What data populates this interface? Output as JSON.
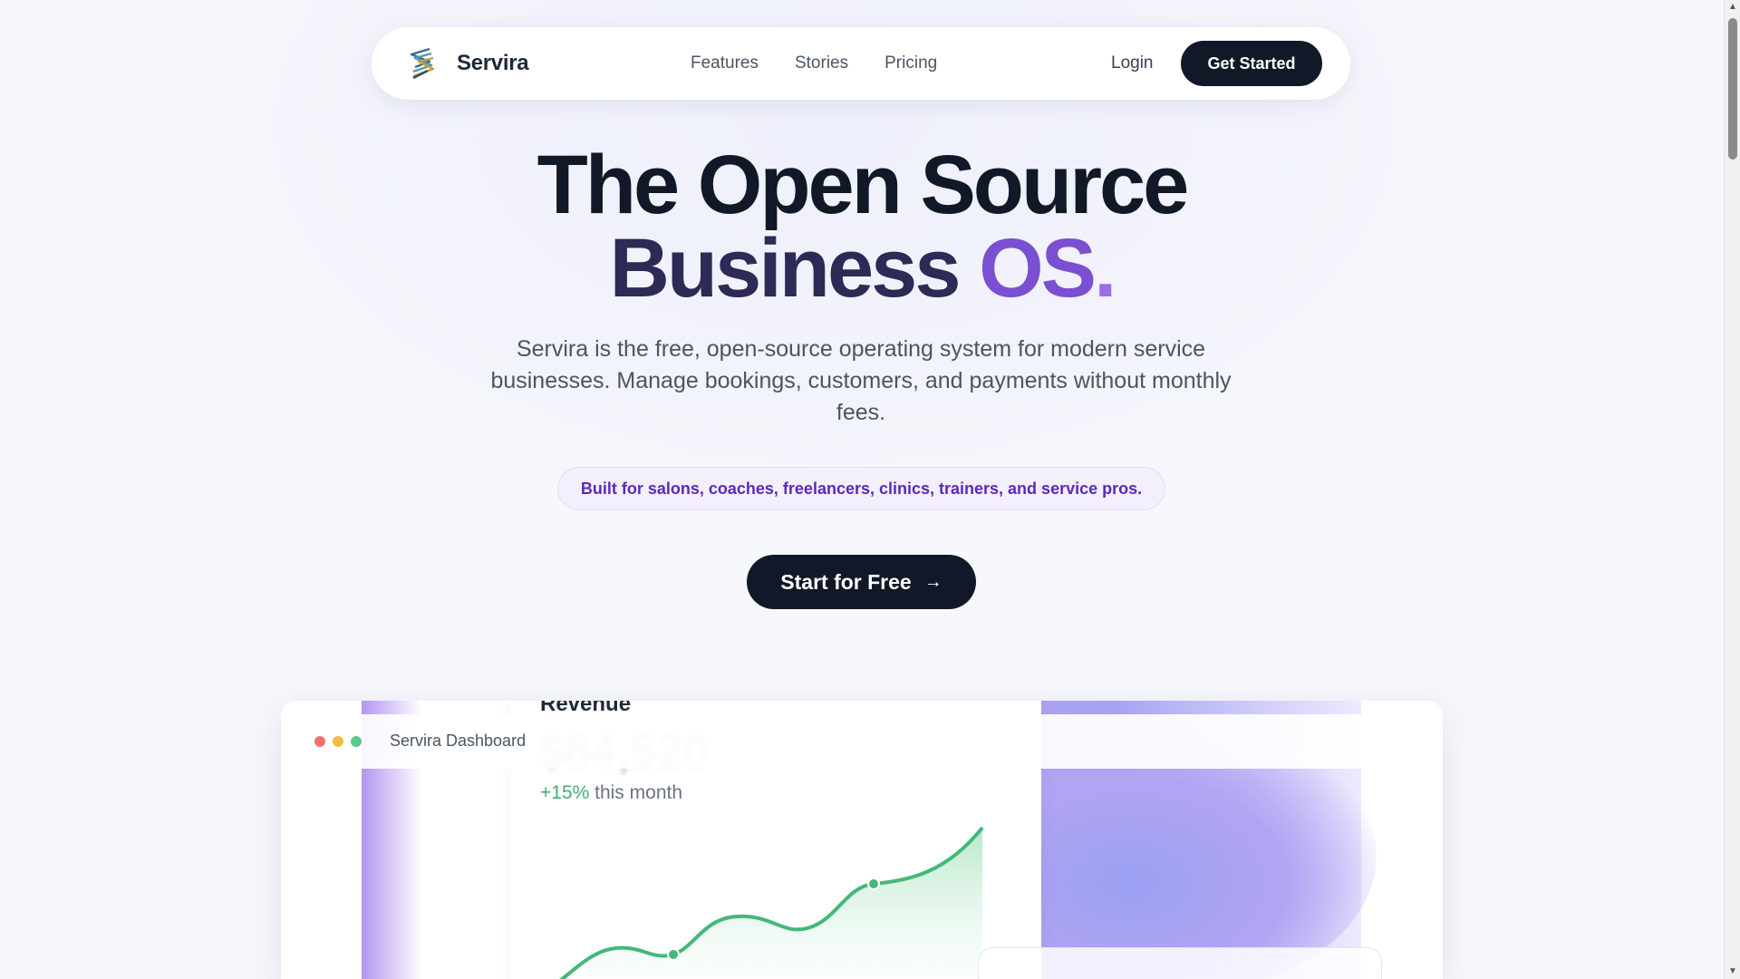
{
  "nav": {
    "brand": "Servira",
    "links": [
      "Features",
      "Stories",
      "Pricing"
    ],
    "login": "Login",
    "cta": "Get Started"
  },
  "hero": {
    "title_line1": "The Open Source",
    "title_line2_a": "Business",
    "title_line2_b": "OS",
    "title_line2_c": ".",
    "subtitle": "Servira is the free, open-source operating system for modern service businesses. Manage bookings, customers, and payments without monthly fees.",
    "audience": "Built for salons, coaches, freelancers, clinics, trainers, and service pros.",
    "cta": "Start for Free",
    "cta_icon": "arrow-right-icon"
  },
  "dashboard": {
    "window_title": "Servira Dashboard",
    "revenue_card": {
      "title": "Revenue",
      "more": "···",
      "amount": "$84,520",
      "change": "+15%",
      "change_suffix": " this month"
    }
  },
  "colors": {
    "dark": "#111827",
    "accent_purple": "#7b4fd1",
    "pill_text": "#5b2bb5",
    "positive_green": "#3fae73"
  }
}
